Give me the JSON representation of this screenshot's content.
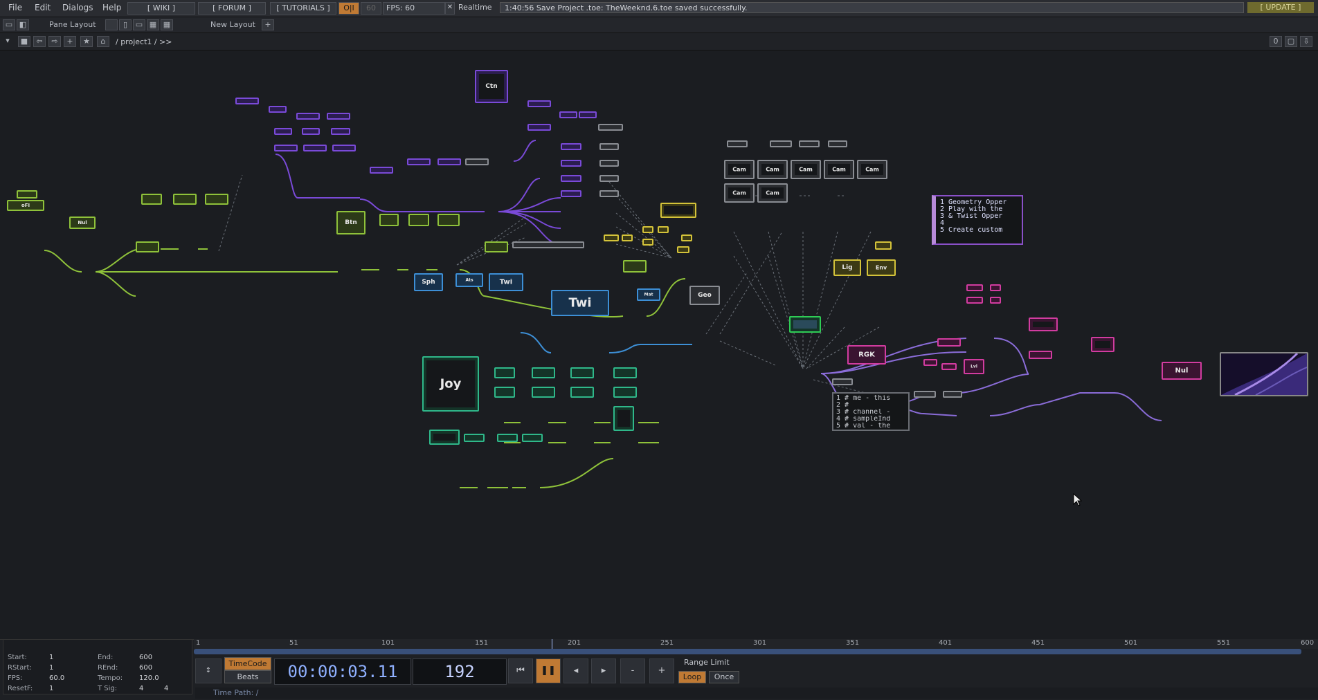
{
  "menu": {
    "file": "File",
    "edit": "Edit",
    "dialogs": "Dialogs",
    "help": "Help"
  },
  "links": {
    "wiki": "[ WIKI ]",
    "forum": "[ FORUM ]",
    "tutorials": "[ TUTORIALS ]"
  },
  "perf": {
    "pause_icon": "O|I",
    "fps_cap": "60",
    "fps_label": "FPS:",
    "fps_value": "60",
    "realtime": "Realtime",
    "realtime_mark": "✕"
  },
  "status": {
    "message": "1:40:56 Save Project .toe: TheWeeknd.6.toe saved successfully.",
    "update": "[ UPDATE ]"
  },
  "pane": {
    "pane_layout": "Pane Layout",
    "new_layout": "New Layout",
    "plus": "+"
  },
  "path": {
    "text": "/ project1 / >>",
    "counter": "0"
  },
  "nodes": {
    "ctn": "Ctn",
    "btn": "Btn",
    "sph": "Sph",
    "twi_small": "Twi",
    "twi_big": "Twi",
    "geo": "Geo",
    "joy": "Joy",
    "rgk": "RGK",
    "nul1": "Nul",
    "nul2": "Nul",
    "lig": "Lig",
    "env": "Env",
    "cam": "Cam"
  },
  "text_dat1": {
    "lines": [
      "1  Geometry Opper",
      "2  Play with the",
      "3  & Twist Opper",
      "4",
      "5  Create custom"
    ]
  },
  "text_dat2": {
    "lines": [
      "1  # me - this",
      "2  #",
      "3  # channel -",
      "4  # sampleInd",
      "5  # val - the"
    ]
  },
  "timeline": {
    "ticks": [
      "1",
      "51",
      "101",
      "151",
      "201",
      "251",
      "301",
      "351",
      "401",
      "451",
      "501",
      "551",
      "600"
    ],
    "start_label": "Start:",
    "start": "1",
    "end_label": "End:",
    "end": "600",
    "rstart_label": "RStart:",
    "rstart": "1",
    "rend_label": "REnd:",
    "rend": "600",
    "fps_label": "FPS:",
    "fps": "60.0",
    "tempo_label": "Tempo:",
    "tempo": "120.0",
    "resetf_label": "ResetF:",
    "resetf": "1",
    "tsig_label": "T Sig:",
    "tsig_a": "4",
    "tsig_b": "4",
    "timecode_btn": "TimeCode",
    "beats_btn": "Beats",
    "timecode": "00:00:03.11",
    "frame": "192",
    "range_limit": "Range Limit",
    "loop": "Loop",
    "once": "Once",
    "time_path": "Time Path: /"
  },
  "colors": {
    "chop": "#8fc23a",
    "top": "#7a4ad8",
    "sop": "#3d8fd6",
    "dat": "#d4c33a",
    "mat": "#d23ca0",
    "comp": "#8a8d93"
  }
}
